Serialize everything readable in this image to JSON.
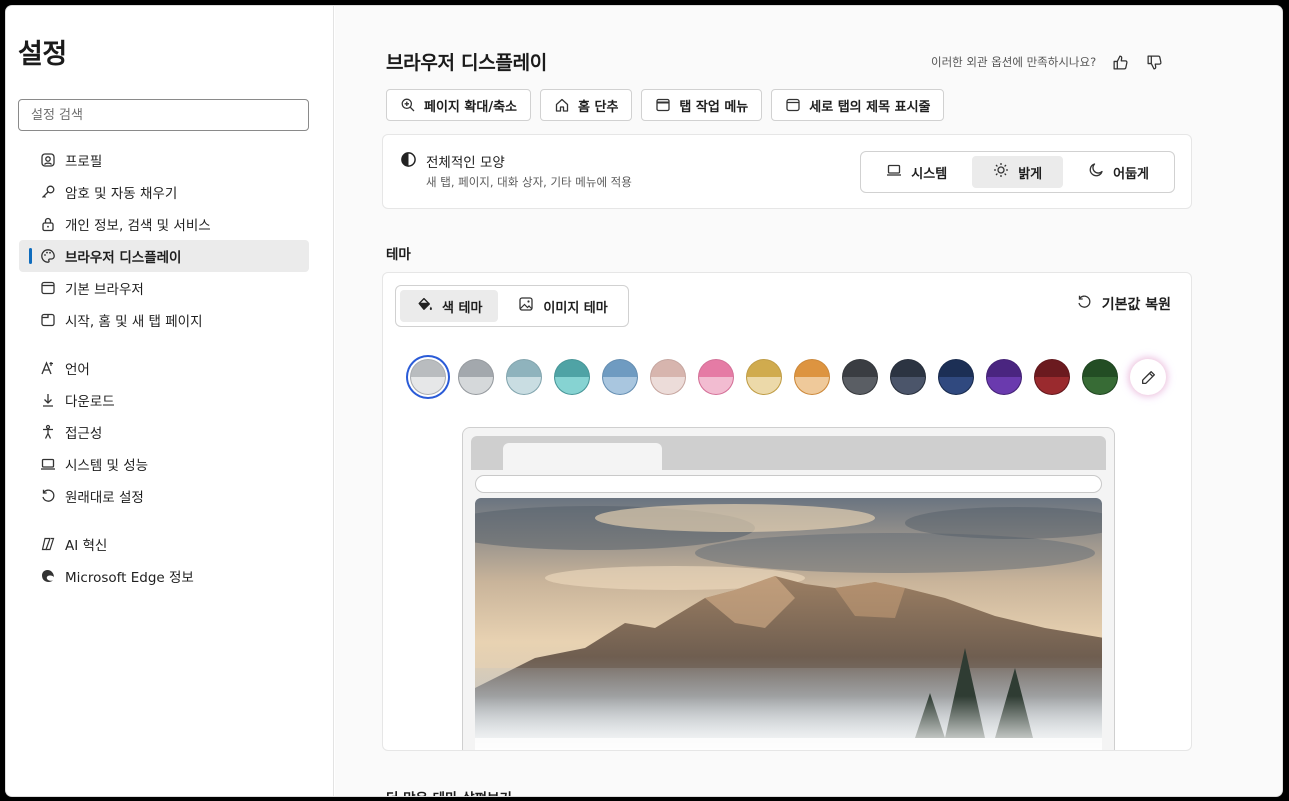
{
  "sidebar": {
    "title": "설정",
    "search_placeholder": "설정 검색",
    "items": [
      {
        "label": "프로필",
        "icon": "profile-icon"
      },
      {
        "label": "암호 및 자동 채우기",
        "icon": "key-icon"
      },
      {
        "label": "개인 정보, 검색 및 서비스",
        "icon": "lock-icon"
      },
      {
        "label": "브라우저 디스플레이",
        "icon": "palette-icon",
        "active": true
      },
      {
        "label": "기본 브라우저",
        "icon": "browser-icon"
      },
      {
        "label": "시작, 홈 및 새 탭 페이지",
        "icon": "new-tab-icon"
      },
      {
        "label": "언어",
        "icon": "language-icon"
      },
      {
        "label": "다운로드",
        "icon": "download-icon"
      },
      {
        "label": "접근성",
        "icon": "accessibility-icon"
      },
      {
        "label": "시스템 및 성능",
        "icon": "laptop-icon"
      },
      {
        "label": "원래대로 설정",
        "icon": "reset-icon"
      },
      {
        "label": "AI 혁신",
        "icon": "copilot-icon"
      },
      {
        "label": "Microsoft Edge 정보",
        "icon": "edge-icon"
      }
    ]
  },
  "header": {
    "title": "브라우저 디스플레이",
    "feedback_prompt": "이러한 외관 옵션에 만족하시나요?"
  },
  "quick_buttons": [
    {
      "label": "페이지 확대/축소",
      "icon": "zoom-icon"
    },
    {
      "label": "홈 단추",
      "icon": "home-icon"
    },
    {
      "label": "탭 작업 메뉴",
      "icon": "tab-actions-icon"
    },
    {
      "label": "세로 탭의 제목 표시줄",
      "icon": "vertical-tab-icon"
    }
  ],
  "appearance": {
    "title": "전체적인 모양",
    "subtitle": "새 탭, 페이지, 대화 상자, 기타 메뉴에 적용",
    "options": [
      {
        "label": "시스템",
        "icon": "laptop-icon"
      },
      {
        "label": "밝게",
        "icon": "sun-icon",
        "selected": true
      },
      {
        "label": "어둡게",
        "icon": "moon-icon"
      }
    ]
  },
  "theme": {
    "section_label": "테마",
    "tabs": [
      {
        "label": "색 테마",
        "icon": "paint-bucket-icon",
        "selected": true
      },
      {
        "label": "이미지 테마",
        "icon": "image-icon"
      }
    ],
    "reset_label": "기본값 복원",
    "swatches": [
      {
        "top": "#b9bcbf",
        "bottom": "#e6e7e8",
        "selected": true
      },
      {
        "top": "#a3a8ad",
        "bottom": "#d5d8da"
      },
      {
        "top": "#8fb3bd",
        "bottom": "#c9dde2"
      },
      {
        "top": "#4fa3a5",
        "bottom": "#86d3d2"
      },
      {
        "top": "#6f9bc1",
        "bottom": "#a9c6df"
      },
      {
        "top": "#d7b5ae",
        "bottom": "#ecdcd9"
      },
      {
        "top": "#e57ba5",
        "bottom": "#f2bcd1"
      },
      {
        "top": "#d0ab4e",
        "bottom": "#ecd9a9"
      },
      {
        "top": "#dd9440",
        "bottom": "#efc99a"
      },
      {
        "top": "#3a3d42",
        "bottom": "#5a5e64"
      },
      {
        "top": "#2c3442",
        "bottom": "#4b556a"
      },
      {
        "top": "#1c2f55",
        "bottom": "#30497f"
      },
      {
        "top": "#4a2580",
        "bottom": "#6a3aae"
      },
      {
        "top": "#6b1a1f",
        "bottom": "#9a2a2e"
      },
      {
        "top": "#234d24",
        "bottom": "#376b35"
      }
    ],
    "picker_icon": "eyedropper-icon"
  },
  "more_themes_label": "더 많은 테마 살펴보기"
}
